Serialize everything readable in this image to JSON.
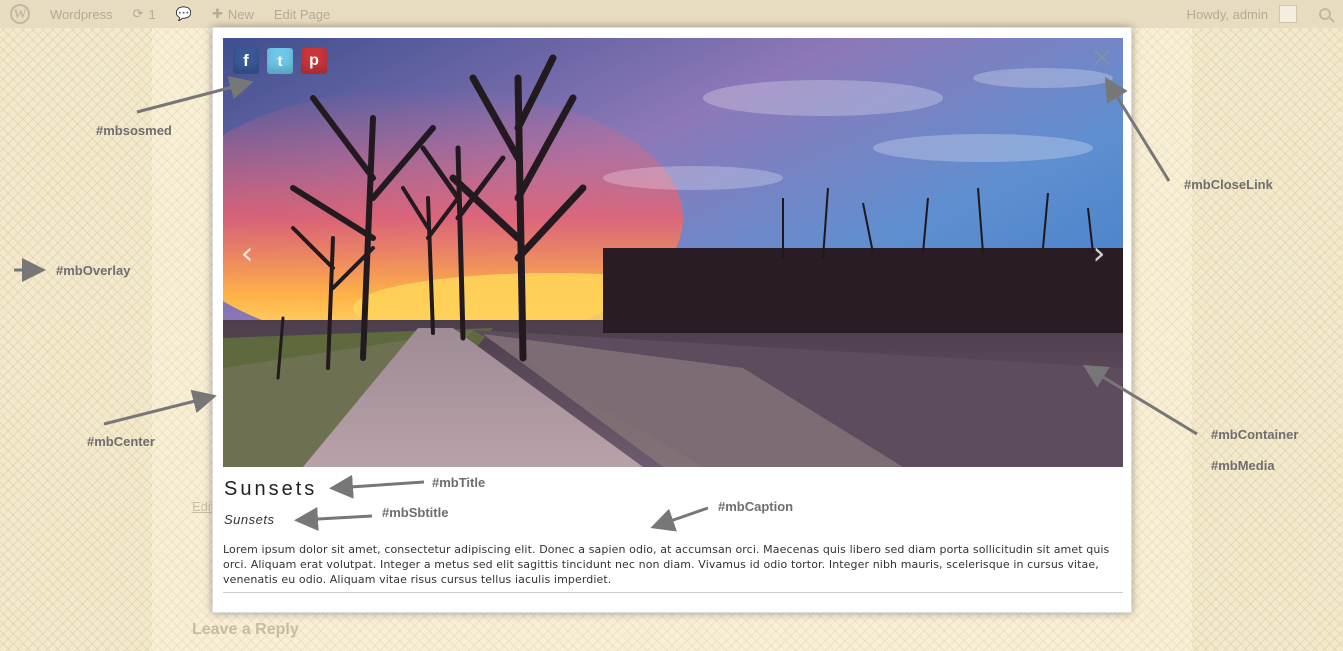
{
  "adminbar": {
    "site_name": "Wordpress",
    "updates_count": "1",
    "new_label": "New",
    "edit_label": "Edit Page",
    "howdy": "Howdy, admin"
  },
  "background": {
    "edit_link": "Edit",
    "leave_reply": "Leave a Reply"
  },
  "lightbox": {
    "social": [
      {
        "name": "facebook",
        "glyph": "f",
        "color": "#3b5998"
      },
      {
        "name": "twitter",
        "glyph": "t",
        "color": "#6ec6e8"
      },
      {
        "name": "pinterest",
        "glyph": "p",
        "color": "#c9353b"
      }
    ],
    "prev_glyph": "‹",
    "next_glyph": "›",
    "title": "Sunsets",
    "subtitle": "Sunsets",
    "caption": "Lorem ipsum dolor sit amet, consectetur adipiscing elit. Donec a sapien odio, at accumsan orci. Maecenas quis libero sed diam porta sollicitudin sit amet quis orci. Aliquam erat volutpat. Integer a metus sed elit sagittis tincidunt nec non diam. Vivamus id odio tortor. Integer nibh mauris, scelerisque in cursus vitae, venenatis eu odio. Aliquam vitae risus cursus tellus iaculis imperdiet."
  },
  "annotations": {
    "sosmed": "#mbsosmed",
    "overlay": "#mbOverlay",
    "center": "#mbCenter",
    "title": "#mbTitle",
    "subtitle": "#mbSbtitle",
    "caption": "#mbCaption",
    "close": "#mbCloseLink",
    "container": "#mbContainer",
    "media": "#mbMedia"
  }
}
